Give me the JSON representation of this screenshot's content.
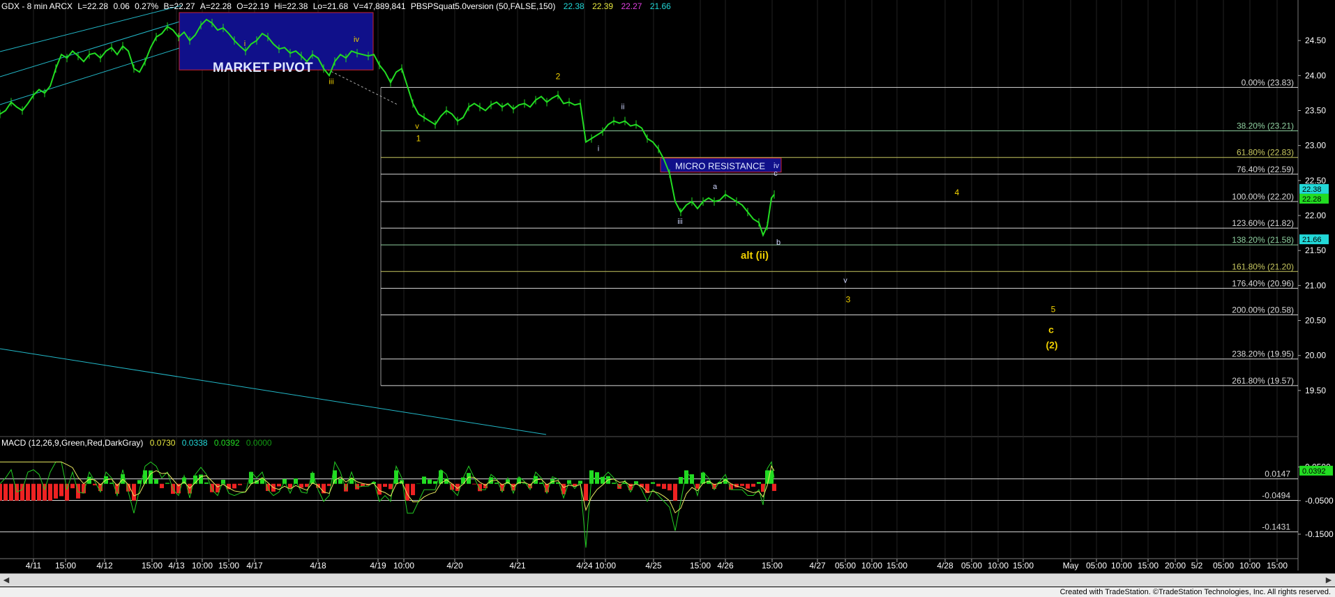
{
  "header": {
    "symbol": "GDX - 8 min  ARCX",
    "last": "L=22.28",
    "change": "0.06",
    "change_pct": "0.27%",
    "bid": "B=22.27",
    "ask": "A=22.28",
    "open": "O=22.19",
    "high": "Hi=22.38",
    "low": "Lo=21.68",
    "volume": "V=47,889,841",
    "indicator": "PBSPSquat5.0version (50,FALSE,150)",
    "ind_v1": "22.38",
    "ind_v2": "22.39",
    "ind_v3": "22.27",
    "ind_v4": "21.66"
  },
  "colors": {
    "price": "#22dd22",
    "channel": "#22b8c8",
    "fib": "#d8d8d8",
    "label_yellow": "#f0d000",
    "box_fill": "#10108a",
    "box_border": "#cc2233",
    "macd_line": "#22cc22",
    "signal_line": "#e8e860",
    "hist_pos": "#22dd22",
    "hist_neg": "#ee2222"
  },
  "chart_data": [
    {
      "type": "line",
      "title": "GDX - 8 min",
      "ylim": [
        19.2,
        24.9
      ],
      "y_ticks": [
        "24.50",
        "24.00",
        "23.50",
        "23.00",
        "22.50",
        "22.00",
        "21.50",
        "21.00",
        "20.50",
        "20.00",
        "19.50"
      ],
      "x_ticks": [
        "4/11",
        "15:00",
        "4/12",
        "15:00",
        "4/13",
        "10:00",
        "15:00",
        "4/17",
        "4/18",
        "4/19",
        "10:00",
        "4/20",
        "4/21",
        "4/24",
        "10:00",
        "4/25",
        "15:00",
        "4/26",
        "15:00",
        "4/27",
        "05:00",
        "10:00",
        "15:00",
        "4/28",
        "05:00",
        "10:00",
        "15:00",
        "May",
        "05:00",
        "10:00",
        "15:00",
        "20:00",
        "5/2",
        "05:00",
        "10:00",
        "15:00"
      ],
      "x_tick_pos": [
        48,
        94,
        150,
        218,
        253,
        290,
        328,
        365,
        456,
        542,
        579,
        652,
        742,
        838,
        868,
        937,
        1004,
        1040,
        1107,
        1172,
        1212,
        1250,
        1286,
        1355,
        1393,
        1431,
        1467,
        1535,
        1572,
        1608,
        1646,
        1685,
        1716,
        1754,
        1792,
        1831
      ],
      "close_series": [
        [
          0,
          23.45
        ],
        [
          8,
          23.5
        ],
        [
          16,
          23.62
        ],
        [
          24,
          23.55
        ],
        [
          32,
          23.5
        ],
        [
          40,
          23.6
        ],
        [
          48,
          23.72
        ],
        [
          56,
          23.8
        ],
        [
          64,
          23.75
        ],
        [
          72,
          23.85
        ],
        [
          80,
          24.1
        ],
        [
          88,
          24.3
        ],
        [
          96,
          24.25
        ],
        [
          104,
          24.35
        ],
        [
          112,
          24.28
        ],
        [
          120,
          24.2
        ],
        [
          128,
          24.3
        ],
        [
          136,
          24.32
        ],
        [
          144,
          24.25
        ],
        [
          152,
          24.35
        ],
        [
          160,
          24.4
        ],
        [
          168,
          24.3
        ],
        [
          176,
          24.42
        ],
        [
          184,
          24.35
        ],
        [
          192,
          24.1
        ],
        [
          200,
          24.05
        ],
        [
          208,
          24.2
        ],
        [
          216,
          24.4
        ],
        [
          224,
          24.55
        ],
        [
          232,
          24.6
        ],
        [
          240,
          24.7
        ],
        [
          248,
          24.65
        ],
        [
          256,
          24.55
        ],
        [
          264,
          24.62
        ],
        [
          272,
          24.5
        ],
        [
          280,
          24.58
        ],
        [
          288,
          24.72
        ],
        [
          296,
          24.8
        ],
        [
          304,
          24.75
        ],
        [
          312,
          24.65
        ],
        [
          320,
          24.68
        ],
        [
          328,
          24.6
        ],
        [
          336,
          24.5
        ],
        [
          344,
          24.42
        ],
        [
          352,
          24.35
        ],
        [
          360,
          24.45
        ],
        [
          368,
          24.5
        ],
        [
          376,
          24.6
        ],
        [
          384,
          24.55
        ],
        [
          392,
          24.45
        ],
        [
          400,
          24.38
        ],
        [
          408,
          24.4
        ],
        [
          416,
          24.32
        ],
        [
          424,
          24.35
        ],
        [
          432,
          24.28
        ],
        [
          440,
          24.2
        ],
        [
          448,
          24.3
        ],
        [
          456,
          24.25
        ],
        [
          464,
          24.1
        ],
        [
          472,
          24.0
        ],
        [
          480,
          24.2
        ],
        [
          488,
          24.3
        ],
        [
          496,
          24.25
        ],
        [
          504,
          24.35
        ],
        [
          512,
          24.32
        ],
        [
          520,
          24.3
        ],
        [
          528,
          24.28
        ],
        [
          536,
          24.3
        ],
        [
          544,
          24.15
        ],
        [
          552,
          24.05
        ],
        [
          560,
          23.9
        ],
        [
          568,
          24.05
        ],
        [
          576,
          24.1
        ],
        [
          584,
          23.85
        ],
        [
          592,
          23.6
        ],
        [
          600,
          23.45
        ],
        [
          608,
          23.4
        ],
        [
          616,
          23.35
        ],
        [
          624,
          23.3
        ],
        [
          632,
          23.42
        ],
        [
          640,
          23.5
        ],
        [
          648,
          23.45
        ],
        [
          656,
          23.35
        ],
        [
          664,
          23.4
        ],
        [
          672,
          23.55
        ],
        [
          680,
          23.6
        ],
        [
          688,
          23.55
        ],
        [
          696,
          23.5
        ],
        [
          704,
          23.58
        ],
        [
          712,
          23.62
        ],
        [
          720,
          23.55
        ],
        [
          728,
          23.6
        ],
        [
          736,
          23.52
        ],
        [
          744,
          23.58
        ],
        [
          752,
          23.6
        ],
        [
          760,
          23.55
        ],
        [
          768,
          23.65
        ],
        [
          776,
          23.7
        ],
        [
          784,
          23.62
        ],
        [
          792,
          23.68
        ],
        [
          800,
          23.72
        ],
        [
          808,
          23.6
        ],
        [
          816,
          23.62
        ],
        [
          824,
          23.58
        ],
        [
          832,
          23.6
        ],
        [
          840,
          23.05
        ],
        [
          848,
          23.1
        ],
        [
          856,
          23.15
        ],
        [
          864,
          23.2
        ],
        [
          872,
          23.3
        ],
        [
          880,
          23.35
        ],
        [
          888,
          23.32
        ],
        [
          896,
          23.35
        ],
        [
          904,
          23.28
        ],
        [
          912,
          23.3
        ],
        [
          920,
          23.25
        ],
        [
          928,
          23.1
        ],
        [
          936,
          23.05
        ],
        [
          944,
          22.95
        ],
        [
          952,
          22.8
        ],
        [
          960,
          22.6
        ],
        [
          968,
          22.2
        ],
        [
          976,
          22.05
        ],
        [
          984,
          22.15
        ],
        [
          992,
          22.2
        ],
        [
          1000,
          22.1
        ],
        [
          1008,
          22.2
        ],
        [
          1016,
          22.25
        ],
        [
          1024,
          22.2
        ],
        [
          1032,
          22.22
        ],
        [
          1040,
          22.3
        ],
        [
          1048,
          22.25
        ],
        [
          1056,
          22.2
        ],
        [
          1064,
          22.15
        ],
        [
          1072,
          22.05
        ],
        [
          1080,
          21.95
        ],
        [
          1088,
          21.9
        ],
        [
          1094,
          21.72
        ],
        [
          1100,
          21.85
        ],
        [
          1106,
          22.25
        ],
        [
          1110,
          22.3
        ]
      ],
      "fib_levels": [
        {
          "label": "0.00% (23.83)",
          "value": 23.83,
          "color": "#d8d8d8"
        },
        {
          "label": "38.20% (23.21)",
          "value": 23.21,
          "color": "#8fd0a0"
        },
        {
          "label": "61.80% (22.83)",
          "value": 22.83,
          "color": "#c8c860"
        },
        {
          "label": "76.40% (22.59)",
          "value": 22.59,
          "color": "#d8d8d8"
        },
        {
          "label": "100.00% (22.20)",
          "value": 22.2,
          "color": "#d8d8d8"
        },
        {
          "label": "123.60% (21.82)",
          "value": 21.82,
          "color": "#d8d8d8"
        },
        {
          "label": "138.20% (21.58)",
          "value": 21.58,
          "color": "#8fd0a0"
        },
        {
          "label": "161.80% (21.20)",
          "value": 21.2,
          "color": "#c8c860"
        },
        {
          "label": "176.40% (20.96)",
          "value": 20.96,
          "color": "#d8d8d8"
        },
        {
          "label": "200.00% (20.58)",
          "value": 20.58,
          "color": "#d8d8d8"
        },
        {
          "label": "238.20% (19.95)",
          "value": 19.95,
          "color": "#d8d8d8"
        },
        {
          "label": "261.80% (19.57)",
          "value": 19.57,
          "color": "#d8d8d8"
        }
      ],
      "price_tags": [
        {
          "label": "22.38",
          "value": 22.38,
          "bg": "#22d8d8",
          "fg": "#000"
        },
        {
          "label": "22.28",
          "value": 22.28,
          "bg": "#22dd22",
          "fg": "#000"
        },
        {
          "label": "21.66",
          "value": 21.66,
          "bg": "#22d8d8",
          "fg": "#000"
        }
      ],
      "boxes": [
        {
          "label": "MARKET PIVOT",
          "y_top": 24.9,
          "y_bottom": 24.08
        },
        {
          "label": "MICRO RESISTANCE",
          "y_top": 22.82,
          "y_bottom": 22.62
        }
      ],
      "wave_labels": [
        {
          "text": "i",
          "value": 24.42,
          "color": "#f0d000",
          "size": 11
        },
        {
          "text": "iv",
          "value": 24.48,
          "color": "#f0d000",
          "size": 11
        },
        {
          "text": "iii",
          "value": 23.88,
          "color": "#f0d000",
          "size": 11
        },
        {
          "text": "v",
          "value": 23.24,
          "color": "#f0d000",
          "size": 11
        },
        {
          "text": "1",
          "value": 23.06,
          "color": "#f0d000",
          "size": 12
        },
        {
          "text": "2",
          "value": 23.95,
          "color": "#f0d000",
          "size": 12
        },
        {
          "text": "ii",
          "value": 23.52,
          "color": "#cfd6ff",
          "size": 11
        },
        {
          "text": "i",
          "value": 22.92,
          "color": "#cfd6ff",
          "size": 11
        },
        {
          "text": "a",
          "value": 22.38,
          "color": "#cfd6ff",
          "size": 11
        },
        {
          "text": "iii",
          "value": 21.88,
          "color": "#cfd6ff",
          "size": 11
        },
        {
          "text": "iv",
          "value": 22.68,
          "color": "#cfd6ff",
          "size": 11
        },
        {
          "text": "c",
          "value": 22.57,
          "color": "#cfd6ff",
          "size": 11
        },
        {
          "text": "b",
          "value": 21.58,
          "color": "#cfd6ff",
          "size": 11
        },
        {
          "text": "alt (ii)",
          "value": 21.38,
          "color": "#f0d000",
          "size": 15
        },
        {
          "text": "v",
          "value": 21.04,
          "color": "#cfd6ff",
          "size": 11
        },
        {
          "text": "3",
          "value": 20.76,
          "color": "#f0d000",
          "size": 12
        },
        {
          "text": "4",
          "value": 22.29,
          "color": "#f0d000",
          "size": 12
        },
        {
          "text": "5",
          "value": 20.62,
          "color": "#f0d000",
          "size": 12
        },
        {
          "text": "c",
          "value": 20.32,
          "color": "#f0d000",
          "size": 14
        },
        {
          "text": "(2)",
          "value": 20.1,
          "color": "#f0d000",
          "size": 14
        }
      ]
    },
    {
      "type": "line",
      "title": "MACD (12,26,9,Green,Red,DarkGray)",
      "values_header": [
        "0.0730",
        "0.0338",
        "0.0392",
        "0.0000"
      ],
      "ylim": [
        -0.2,
        0.07
      ],
      "y_ticks": [
        "0.0500",
        "-0.0500",
        "-0.1500"
      ],
      "levels": [
        {
          "label": "0.0147",
          "value": 0.0147
        },
        {
          "label": "-0.0494",
          "value": -0.0494
        },
        {
          "label": "-0.1431",
          "value": -0.1431
        }
      ],
      "macd_tag": {
        "label": "0.0392",
        "value": 0.0392
      }
    }
  ],
  "footer": {
    "credit": "Created with TradeStation. ©TradeStation Technologies, Inc. All rights reserved."
  }
}
